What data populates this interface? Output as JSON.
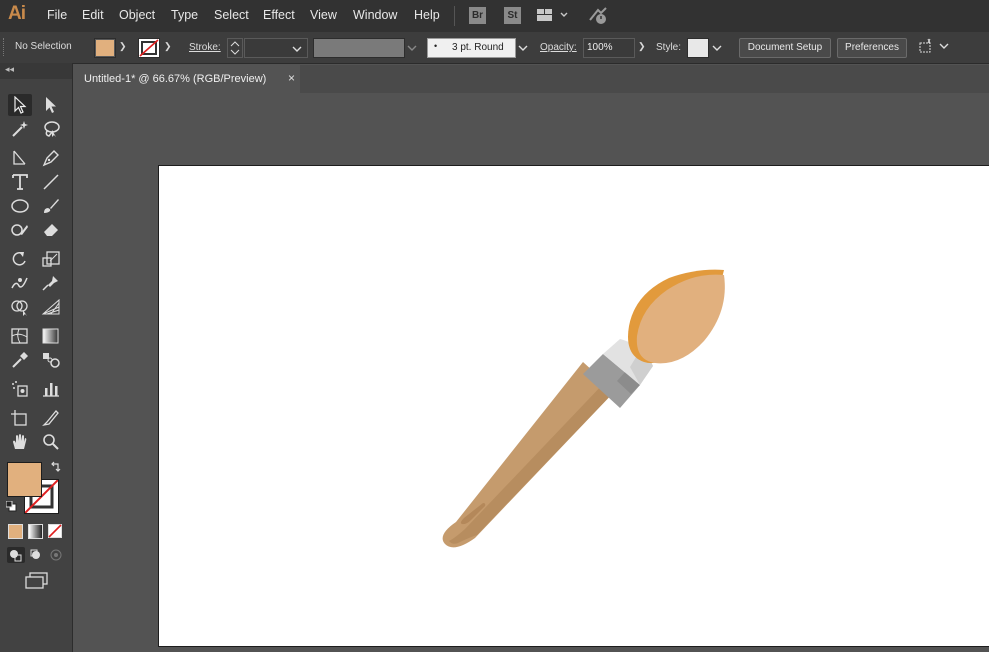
{
  "app": {
    "logo": "Ai",
    "menu": [
      "File",
      "Edit",
      "Object",
      "Type",
      "Select",
      "Effect",
      "View",
      "Window",
      "Help"
    ],
    "bridge_label": "Br",
    "stock_label": "St"
  },
  "options_bar": {
    "selection_status": "No Selection",
    "fill_color": "#e1b07e",
    "stroke_label": "Stroke:",
    "brush_label": "3 pt. Round",
    "opacity_label": "Opacity:",
    "opacity_value": "100%",
    "style_label": "Style:",
    "document_setup": "Document Setup",
    "preferences": "Preferences"
  },
  "document": {
    "tab_title": "Untitled-1* @ 66.67% (RGB/Preview)",
    "close_symbol": "×"
  },
  "tools": {
    "collapse_symbol": "◂◂",
    "fill_color": "#e1b07e",
    "stroke_color": "#ffffff"
  },
  "colors": {
    "menubar": "#323232",
    "panel": "#424242",
    "canvas": "#535353",
    "brush_tip": "#e1b07e",
    "brush_tip_edge": "#e29a3c",
    "handle": "#c59b6d",
    "handle_shadow": "#b78d5f",
    "ferrule": "#9b9b9b"
  }
}
